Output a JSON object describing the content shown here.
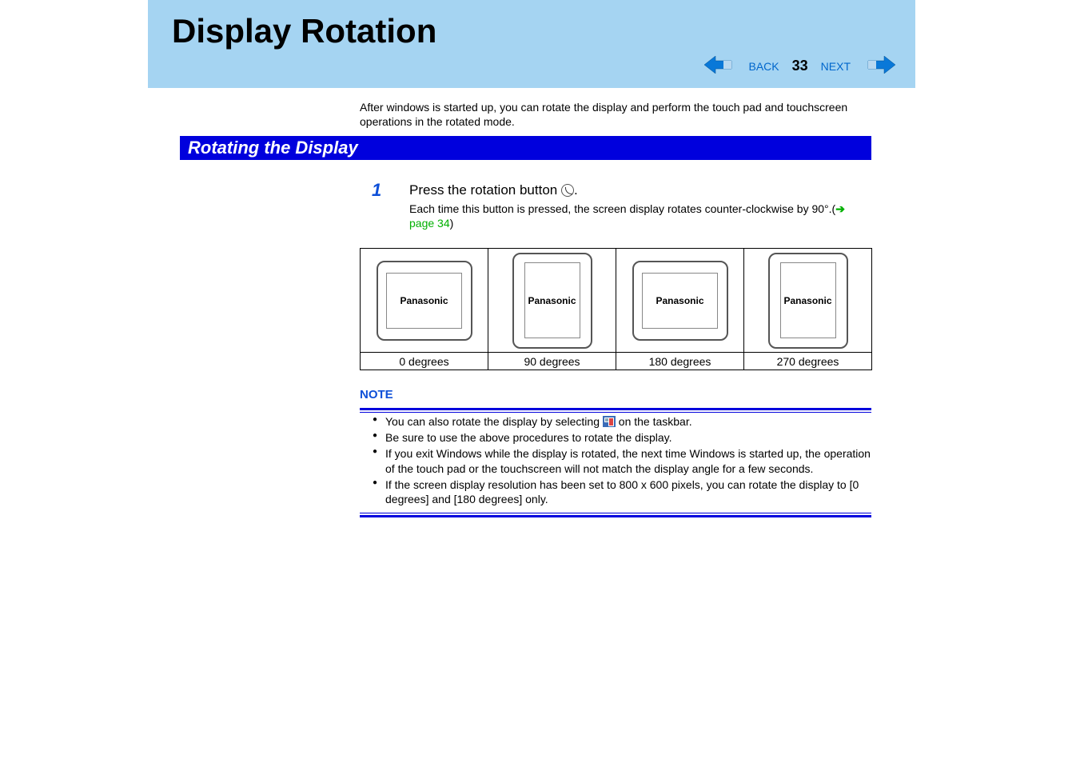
{
  "header": {
    "title": "Display Rotation",
    "back": "BACK",
    "next": "NEXT",
    "page_number": "33"
  },
  "intro": "After windows is started up, you can rotate the display and perform the touch pad and touchscreen operations in the rotated mode.",
  "section_heading": "Rotating the Display",
  "step": {
    "number": "1",
    "heading_before": "Press the rotation button ",
    "heading_after": ".",
    "body_before": "Each time this button is pressed, the screen display rotates counter-clockwise by 90°.(",
    "link_text": "page 34",
    "body_after": ")"
  },
  "diagrams": {
    "brand": "Panasonic",
    "captions": [
      "0 degrees",
      "90 degrees",
      "180 degrees",
      "270 degrees"
    ]
  },
  "note": {
    "title": "NOTE",
    "items": [
      {
        "before": "You can also rotate the display by selecting ",
        "after": " on the taskbar.",
        "has_icon": true
      },
      {
        "before": "Be sure to use the above procedures to rotate the display.",
        "after": "",
        "has_icon": false
      },
      {
        "before": "If you exit Windows while the display is rotated, the next time Windows is started up, the operation of the touch pad or the touchscreen will not match the display angle for a few seconds.",
        "after": "",
        "has_icon": false
      },
      {
        "before": "If the screen display resolution has been set to 800 x 600 pixels, you can rotate the display to [0 degrees] and [180 degrees] only.",
        "after": "",
        "has_icon": false
      }
    ]
  }
}
